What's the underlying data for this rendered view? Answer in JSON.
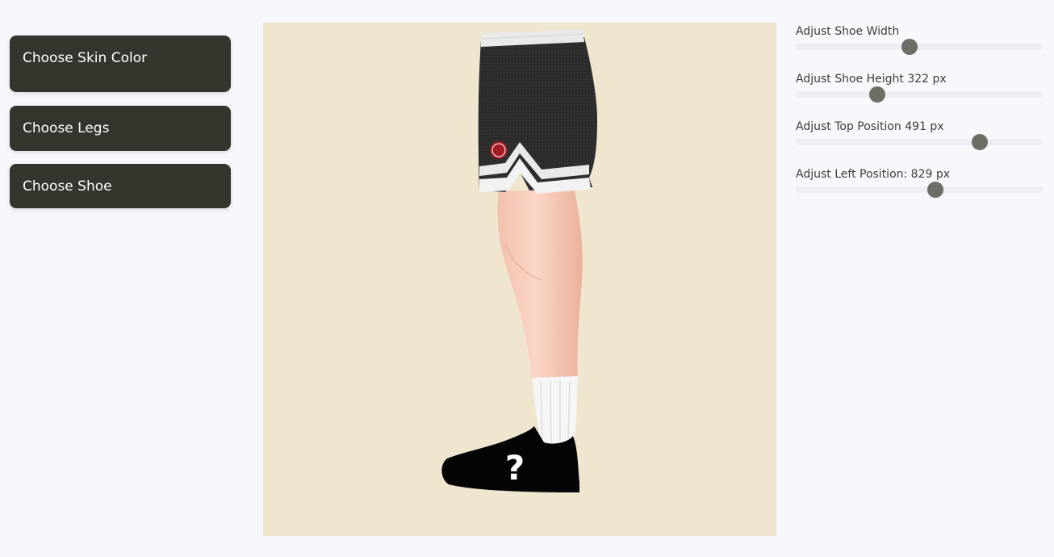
{
  "menu": {
    "skin_label": "Choose Skin Color",
    "legs_label": "Choose Legs",
    "shoe_label": "Choose Shoe"
  },
  "preview": {
    "background_color": "#f0e6d0",
    "shorts_color": "#2c2c2c",
    "trim_color": "#e9e9e9",
    "shoe_color": "#050505",
    "shoe_placeholder": "?"
  },
  "sliders": [
    {
      "label": "Adjust Shoe Width",
      "value": 0.46
    },
    {
      "label": "Adjust Shoe Height 322 px",
      "value": 0.33
    },
    {
      "label": "Adjust Top Position 491 px",
      "value": 0.745
    },
    {
      "label": "Adjust Left Position: 829 px",
      "value": 0.565
    }
  ]
}
